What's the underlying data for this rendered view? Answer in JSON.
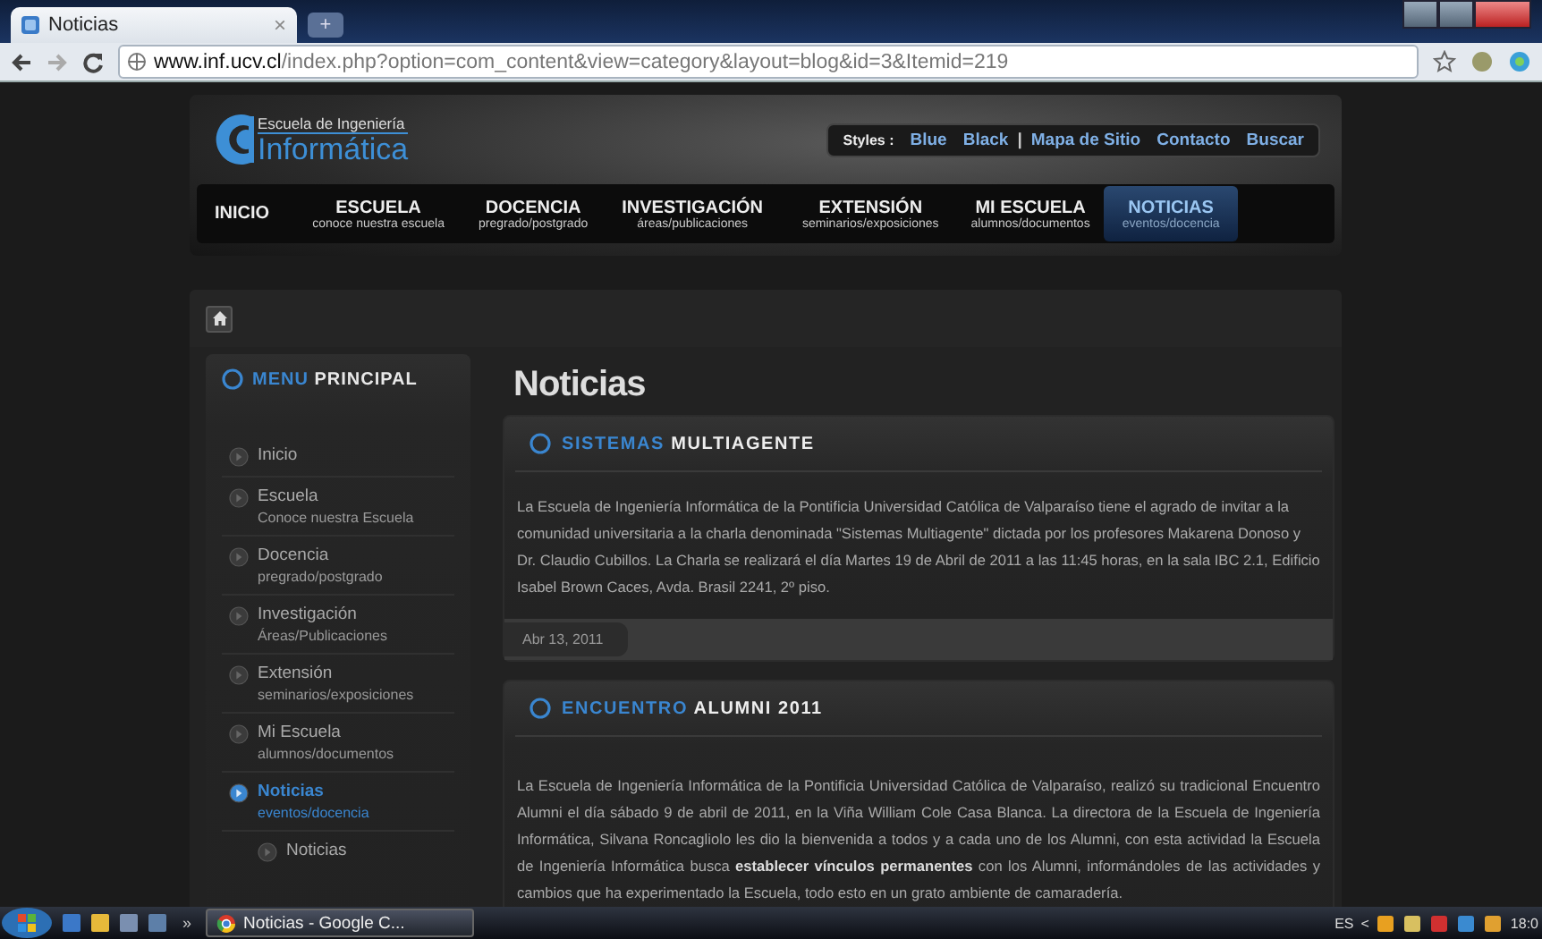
{
  "browser": {
    "tab": {
      "title": "Noticias",
      "close": "×"
    },
    "new_tab": "+",
    "url_host": "www.inf.ucv.cl",
    "url_path": "/index.php?option=com_content&view=category&layout=blog&id=3&Itemid=219"
  },
  "header": {
    "logo_top": "Escuela de Ingeniería",
    "logo_bottom": "Informática",
    "styles_label": "Styles :",
    "links": [
      {
        "label": "Blue",
        "kind": "link"
      },
      {
        "label": "Black",
        "kind": "link"
      },
      {
        "label": "|",
        "kind": "separator"
      },
      {
        "label": "Mapa de Sitio",
        "kind": "link"
      },
      {
        "label": "Contacto",
        "kind": "link"
      },
      {
        "label": "Buscar",
        "kind": "link"
      }
    ]
  },
  "nav": [
    {
      "title": "INICIO",
      "selected": false
    },
    {
      "title": "ESCUELA",
      "sub": "conoce nuestra escuela",
      "selected": false
    },
    {
      "title": "DOCENCIA",
      "sub": "pregrado/postgrado",
      "selected": false
    },
    {
      "title": "INVESTIGACIÓN",
      "sub": "áreas/publicaciones",
      "selected": false
    },
    {
      "title": "EXTENSIÓN",
      "sub": "seminarios/exposiciones",
      "selected": false
    },
    {
      "title": "MI ESCUELA",
      "sub": "alumnos/documentos",
      "selected": false
    },
    {
      "title": "NOTICIAS",
      "sub": "eventos/docencia",
      "selected": true
    }
  ],
  "sidebar": {
    "title_accent": "MENU",
    "title_rest": "PRINCIPAL",
    "items": [
      {
        "label": "Inicio",
        "selected": false
      },
      {
        "label": "Escuela",
        "sub": "Conoce nuestra Escuela",
        "selected": false
      },
      {
        "label": "Docencia",
        "sub": "pregrado/postgrado",
        "selected": false
      },
      {
        "label": "Investigación",
        "sub": "Áreas/Publicaciones",
        "selected": false
      },
      {
        "label": "Extensión",
        "sub": "seminarios/exposiciones",
        "selected": false
      },
      {
        "label": "Mi Escuela",
        "sub": "alumnos/documentos",
        "selected": false
      },
      {
        "label": "Noticias",
        "sub": "eventos/docencia",
        "selected": true,
        "children": [
          {
            "label": "Noticias",
            "selected": false
          }
        ]
      }
    ]
  },
  "page_title": "Noticias",
  "articles": [
    {
      "title_accent": "SISTEMAS",
      "title_rest": "MULTIAGENTE",
      "body": "La Escuela de Ingeniería Informática de la Pontificia Universidad Católica de Valparaíso tiene el agrado de invitar a la comunidad universitaria a la charla denominada \"Sistemas Multiagente\" dictada por los profesores Makarena Donoso y Dr. Claudio Cubillos. La Charla se realizará el día Martes 19 de Abril de 2011 a las 11:45 horas, en la sala IBC 2.1, Edificio Isabel Brown Caces, Avda. Brasil 2241, 2º piso.",
      "date": "Abr 13, 2011"
    },
    {
      "title_accent": "ENCUENTRO",
      "title_rest": "ALUMNI 2011",
      "body": "La Escuela de Ingeniería Informática de la Pontificia Universidad Católica de Valparaíso, realizó su tradicional Encuentro Alumni el día sábado 9 de abril de 2011, en la Viña William Cole Casa Blanca. La directora de la Escuela de Ingeniería Informática, Silvana Roncagliolo les dio la bienvenida a todos y a cada uno de los Alumni, con esta actividad la Escuela de Ingeniería Informática  busca **establecer vínculos permanentes** con los Alumni, informándoles de las actividades y cambios que ha experimentado la Escuela,  todo esto en un grato ambiente de camaradería."
    }
  ],
  "taskbar": {
    "more": "»",
    "task": "Noticias - Google C...",
    "lang": "ES",
    "tray_arrow": "<",
    "clock": "18:0"
  }
}
